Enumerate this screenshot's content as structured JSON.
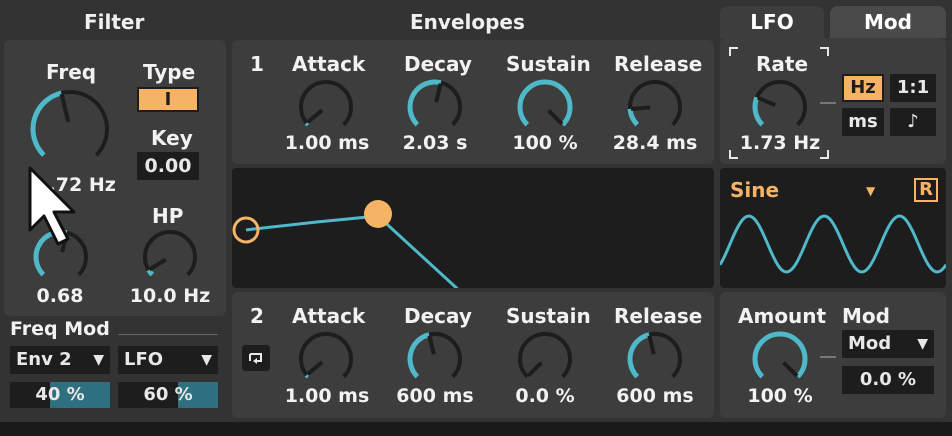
{
  "sections": {
    "filter": "Filter",
    "envelopes": "Envelopes"
  },
  "tabs": [
    {
      "label": "LFO",
      "active": true
    },
    {
      "label": "Mod",
      "active": false
    }
  ],
  "filter": {
    "freq_label": "Freq",
    "freq_value": "...72 Hz",
    "freq_level": 0.45,
    "type_label": "Type",
    "type_value": "I",
    "key_label": "Key",
    "key_value": "0.00",
    "res_value": "0.68",
    "res_level": 0.55,
    "hp_label": "HP",
    "hp_value": "10.0 Hz",
    "hp_level": 0.05
  },
  "freq_mod": {
    "label": "Freq Mod",
    "source1": "Env 2",
    "amount1": "40 %",
    "amount1_level": 0.4,
    "source2": "LFO",
    "amount2": "60 %",
    "amount2_level": 0.6
  },
  "env1": {
    "number": "1",
    "attack_label": "Attack",
    "attack_value": "1.00 ms",
    "attack_level": 0.02,
    "decay_label": "Decay",
    "decay_value": "2.03 s",
    "decay_level": 0.55,
    "sustain_label": "Sustain",
    "sustain_value": "100 %",
    "sustain_level": 1.0,
    "release_label": "Release",
    "release_value": "28.4 ms",
    "release_level": 0.15
  },
  "env2": {
    "number": "2",
    "attack_label": "Attack",
    "attack_value": "1.00 ms",
    "attack_level": 0.02,
    "decay_label": "Decay",
    "decay_value": "600 ms",
    "decay_level": 0.45,
    "sustain_label": "Sustain",
    "sustain_value": "0.0 %",
    "sustain_level": 0.0,
    "release_label": "Release",
    "release_value": "600 ms",
    "release_level": 0.45
  },
  "lfo": {
    "rate_label": "Rate",
    "rate_value": "1.73 Hz",
    "rate_level": 0.25,
    "hz_btn": "Hz",
    "ratio_btn": "1:1",
    "ms_btn": "ms",
    "note_btn": "♪",
    "shape": "Sine",
    "retrigger": "R"
  },
  "mod": {
    "amount_label": "Amount",
    "amount_value": "100 %",
    "amount_level": 1.0,
    "mod_label": "Mod",
    "mod_select": "Mod",
    "mod_value": "0.0 %"
  },
  "colors": {
    "accent": "#4fb8c9",
    "orange": "#f5b366",
    "panel": "#3d3d3d",
    "display": "#1d1d1d"
  }
}
